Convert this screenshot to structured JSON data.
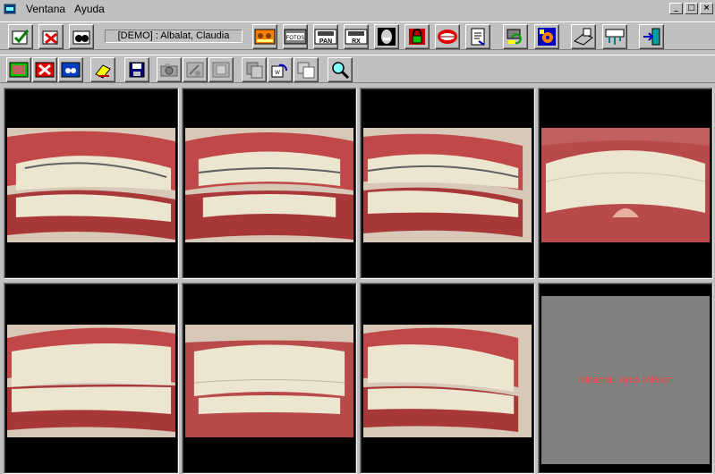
{
  "menu": {
    "items": [
      "Ventana",
      "Ayuda"
    ],
    "window_buttons": [
      "_",
      "□",
      "×"
    ]
  },
  "toolbar1": {
    "patient_label": "[DEMO] : Albalat, Claudia",
    "buttons": [
      {
        "name": "accept-icon",
        "label": ""
      },
      {
        "name": "cancel-icon",
        "label": ""
      },
      {
        "name": "binoculars-icon",
        "label": ""
      },
      {
        "name": "patient-card-icon",
        "label": ""
      },
      {
        "name": "fotos-icon",
        "label": "FOTOS"
      },
      {
        "name": "pan-icon",
        "label": "PAN"
      },
      {
        "name": "rx-icon",
        "label": "RX"
      },
      {
        "name": "xray-face-icon",
        "label": ""
      },
      {
        "name": "lock-icon",
        "label": ""
      },
      {
        "name": "mouth-icon",
        "label": ""
      },
      {
        "name": "document-icon",
        "label": ""
      },
      {
        "name": "refresh-icon",
        "label": ""
      },
      {
        "name": "settings-icon",
        "label": ""
      },
      {
        "name": "scanner-icon",
        "label": ""
      },
      {
        "name": "database-icon",
        "label": ""
      },
      {
        "name": "exit-icon",
        "label": ""
      }
    ]
  },
  "toolbar2": {
    "buttons": [
      {
        "name": "image-ok-icon"
      },
      {
        "name": "image-delete-icon"
      },
      {
        "name": "image-search-icon"
      },
      {
        "name": "eraser-icon"
      },
      {
        "name": "save-icon"
      },
      {
        "name": "camera-icon"
      },
      {
        "name": "image-edit-icon"
      },
      {
        "name": "image-frame-icon"
      },
      {
        "name": "copy-icon"
      },
      {
        "name": "rotate-icon"
      },
      {
        "name": "stack-icon"
      },
      {
        "name": "zoom-icon"
      }
    ]
  },
  "grid": {
    "empty_slot_label": "Intraoral: Arco Inferior"
  },
  "colors": {
    "face": "#c0c0c0",
    "gum": "#b84a4a",
    "tooth": "#ece6d0",
    "empty_text": "#ff4040"
  }
}
